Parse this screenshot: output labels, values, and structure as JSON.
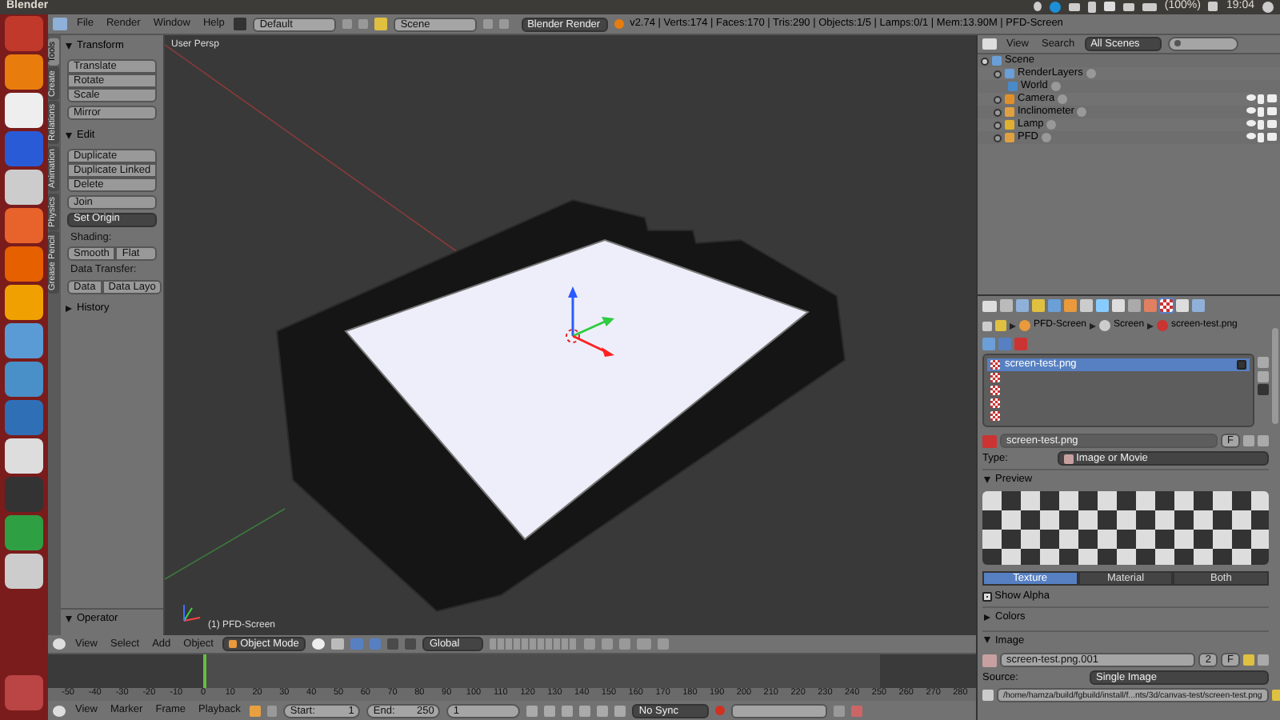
{
  "title_bar": {
    "title": "Blender",
    "battery": "(100%)",
    "time": "19:04"
  },
  "info_header": {
    "menus": [
      "File",
      "Render",
      "Window",
      "Help"
    ],
    "layout": "Default",
    "scene": "Scene",
    "engine": "Blender Render",
    "stats": "v2.74 | Verts:174 | Faces:170 | Tris:290 | Objects:1/5 | Lamps:0/1 | Mem:13.90M | PFD-Screen"
  },
  "tool_shelf": {
    "tabs": [
      {
        "label": "Tools",
        "selected": true
      },
      {
        "label": "Create",
        "selected": false
      },
      {
        "label": "Relations",
        "selected": false
      },
      {
        "label": "Animation",
        "selected": false
      },
      {
        "label": "Physics",
        "selected": false
      },
      {
        "label": "Grease Pencil",
        "selected": false
      }
    ],
    "panels": [
      {
        "title": "Transform",
        "expanded": true,
        "rows": [
          {
            "kind": "stack",
            "items": [
              "Translate",
              "Rotate",
              "Scale"
            ]
          },
          {
            "kind": "stack",
            "items": [
              "Mirror"
            ]
          }
        ]
      },
      {
        "title": "Edit",
        "expanded": true,
        "rows": [
          {
            "kind": "stack",
            "items": [
              "Duplicate",
              "Duplicate Linked",
              "Delete"
            ]
          },
          {
            "kind": "stack",
            "items": [
              "Join"
            ]
          },
          {
            "kind": "dropdown",
            "items": [
              "Set Origin"
            ]
          },
          {
            "kind": "label",
            "items": [
              "Shading:"
            ]
          },
          {
            "kind": "split",
            "items": [
              "Smooth",
              "Flat"
            ]
          },
          {
            "kind": "label",
            "items": [
              "Data Transfer:"
            ]
          },
          {
            "kind": "split",
            "items": [
              "Data",
              "Data Layo"
            ]
          }
        ]
      },
      {
        "title": "History",
        "expanded": false
      }
    ],
    "operator": {
      "title": "Operator",
      "expanded": true
    }
  },
  "viewport": {
    "view_label": "User Persp",
    "object_label": "(1) PFD-Screen"
  },
  "view3d_header": {
    "menus": [
      "View",
      "Select",
      "Add",
      "Object"
    ],
    "mode": "Object Mode",
    "orientation": "Global"
  },
  "timeline": {
    "ruler": [
      "-50",
      "-40",
      "-30",
      "-20",
      "-10",
      "0",
      "10",
      "20",
      "30",
      "40",
      "50",
      "60",
      "70",
      "80",
      "90",
      "100",
      "110",
      "120",
      "130",
      "140",
      "150",
      "160",
      "170",
      "180",
      "190",
      "200",
      "210",
      "220",
      "230",
      "240",
      "250",
      "260",
      "270",
      "280"
    ]
  },
  "timeline_header": {
    "menus": [
      "View",
      "Marker",
      "Frame",
      "Playback"
    ],
    "start_label": "Start:",
    "start": "1",
    "end_label": "End:",
    "end": "250",
    "current_frame": "1",
    "sync": "No Sync"
  },
  "outliner": {
    "menus": [
      "View",
      "Search"
    ],
    "filter": "All Scenes",
    "tree": [
      {
        "label": "Scene",
        "expanded": true,
        "children": [
          {
            "label": "RenderLayers",
            "expanded": false,
            "restrict_icons": false
          },
          {
            "label": "World",
            "restrict_icons": false
          },
          {
            "label": "Camera",
            "expanded": false,
            "restrict_icons": true
          },
          {
            "label": "Inclinometer",
            "expanded": false,
            "restrict_icons": true
          },
          {
            "label": "Lamp",
            "expanded": false,
            "restrict_icons": true
          },
          {
            "label": "PFD",
            "expanded": false,
            "restrict_icons": true
          }
        ]
      }
    ]
  },
  "properties": {
    "context_tabs": [
      {
        "selected": false
      },
      {
        "selected": false
      },
      {
        "selected": false
      },
      {
        "selected": false
      },
      {
        "selected": false
      },
      {
        "selected": false
      },
      {
        "selected": false
      },
      {
        "selected": false
      },
      {
        "selected": false
      },
      {
        "selected": false
      },
      {
        "selected": true
      },
      {
        "selected": false
      },
      {
        "selected": false
      }
    ],
    "breadcrumb": [
      "PFD-Screen",
      "Screen",
      "screen-test.png"
    ],
    "slots": [
      {
        "label": "screen-test.png",
        "selected": true,
        "checked": true
      },
      {
        "selected": false
      },
      {
        "selected": false
      },
      {
        "selected": false
      },
      {
        "selected": false
      }
    ],
    "texture_name": "screen-test.png",
    "fake_user": "F",
    "type_label": "Type:",
    "type": "Image or Movie",
    "preview": {
      "title": "Preview",
      "expanded": true,
      "tabs": [
        {
          "label": "Texture",
          "selected": true
        },
        {
          "label": "Material",
          "selected": false
        },
        {
          "label": "Both",
          "selected": false
        }
      ],
      "show_alpha": {
        "label": "Show Alpha",
        "checked": true
      }
    },
    "colors": {
      "title": "Colors",
      "expanded": false
    },
    "image": {
      "title": "Image",
      "expanded": true,
      "name": "screen-test.png.001",
      "users": "2",
      "fake_user": "F",
      "source_label": "Source:",
      "source": "Single Image",
      "path": "/home/hamza/build/fgbuild/install/f...nts/3d/canvas-test/screen-test.png"
    }
  }
}
